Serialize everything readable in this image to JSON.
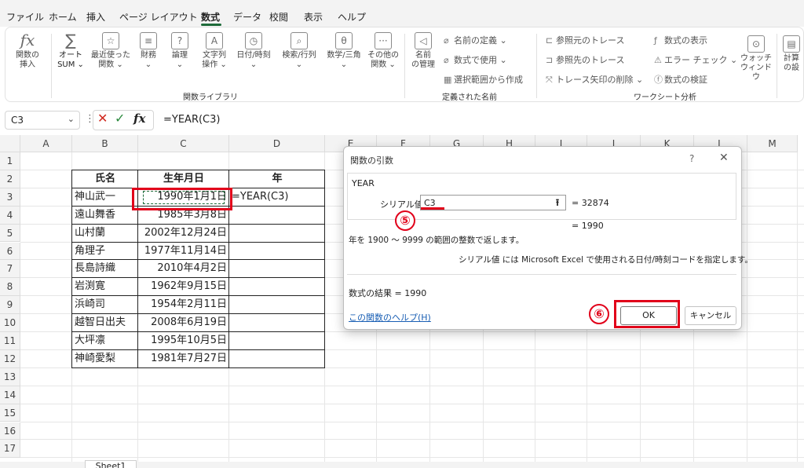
{
  "menu": {
    "items": [
      "ファイル",
      "ホーム",
      "挿入",
      "ページ レイアウト",
      "数式",
      "データ",
      "校閲",
      "表示",
      "ヘルプ"
    ],
    "active": "数式"
  },
  "ribbon": {
    "insert_function": "関数の\n挿入",
    "autosum": "オート\nSUM ⌄",
    "recent": "最近使った\n関数 ⌄",
    "financial": "財務\n⌄",
    "logical": "論理\n⌄",
    "text": "文字列\n操作 ⌄",
    "datetime": "日付/時刻\n⌄",
    "lookup": "検索/行列\n⌄",
    "math": "数学/三角\n⌄",
    "other": "その他の\n関数 ⌄",
    "library_label": "関数ライブラリ",
    "name_manager": "名前\nの管理",
    "define_name": "名前の定義 ⌄",
    "use_in_formula": "数式で使用 ⌄",
    "create_from_selection": "選択範囲から作成",
    "defined_names_label": "定義された名前",
    "trace_precedents": "参照元のトレース",
    "trace_dependents": "参照先のトレース",
    "remove_arrows": "トレース矢印の削除 ⌄",
    "show_formulas": "数式の表示",
    "error_checking": "エラー チェック ⌄",
    "evaluate_formula": "数式の検証",
    "auditing_label": "ワークシート分析",
    "watch_window": "ウォッチ\nウィンドウ",
    "calc_options": "計算\nの設"
  },
  "formula_bar": {
    "name_box": "C3",
    "fx": "fx",
    "formula": "=YEAR(C3)"
  },
  "grid": {
    "columns": [
      "A",
      "B",
      "C",
      "D",
      "E",
      "F",
      "G",
      "H",
      "I",
      "J",
      "K",
      "L",
      "M"
    ],
    "rows": [
      "1",
      "2",
      "3",
      "4",
      "5",
      "6",
      "7",
      "8",
      "9",
      "10",
      "11",
      "12",
      "13",
      "14",
      "15",
      "16",
      "17"
    ],
    "header": [
      "氏名",
      "生年月日",
      "年"
    ],
    "data": [
      {
        "name": "神山武一",
        "birth": "1990年1月1日",
        "year": "=YEAR(C3)"
      },
      {
        "name": "遠山舞香",
        "birth": "1985年3月8日",
        "year": ""
      },
      {
        "name": "山村蘭",
        "birth": "2002年12月24日",
        "year": ""
      },
      {
        "name": "角理子",
        "birth": "1977年11月14日",
        "year": ""
      },
      {
        "name": "長島詩織",
        "birth": "2010年4月2日",
        "year": ""
      },
      {
        "name": "岩渕寛",
        "birth": "1962年9月15日",
        "year": ""
      },
      {
        "name": "浜崎司",
        "birth": "1954年2月11日",
        "year": ""
      },
      {
        "name": "越智日出夫",
        "birth": "2008年6月19日",
        "year": ""
      },
      {
        "name": "大坪凛",
        "birth": "1995年10月5日",
        "year": ""
      },
      {
        "name": "神崎愛梨",
        "birth": "1981年7月27日",
        "year": ""
      }
    ]
  },
  "sheet_tab": "Sheet1",
  "dialog": {
    "title": "関数の引数",
    "help_mark": "?",
    "close": "✕",
    "function_name": "YEAR",
    "arg_label": "シリアル値",
    "arg_value": "C3",
    "arg_result": "=  32874",
    "result_preview": "=  1990",
    "description": "年を 1900 ～ 9999 の範囲の整数で返します。",
    "arg_description": "シリアル値  には Microsoft Excel で使用される日付/時刻コードを指定します。",
    "formula_result": "数式の結果 =   1990",
    "help_link": "この関数のヘルプ(H)",
    "ok": "OK",
    "cancel": "キャンセル"
  },
  "annotations": {
    "step5": "⑤",
    "step6": "⑥",
    "color": "#e1001a"
  }
}
